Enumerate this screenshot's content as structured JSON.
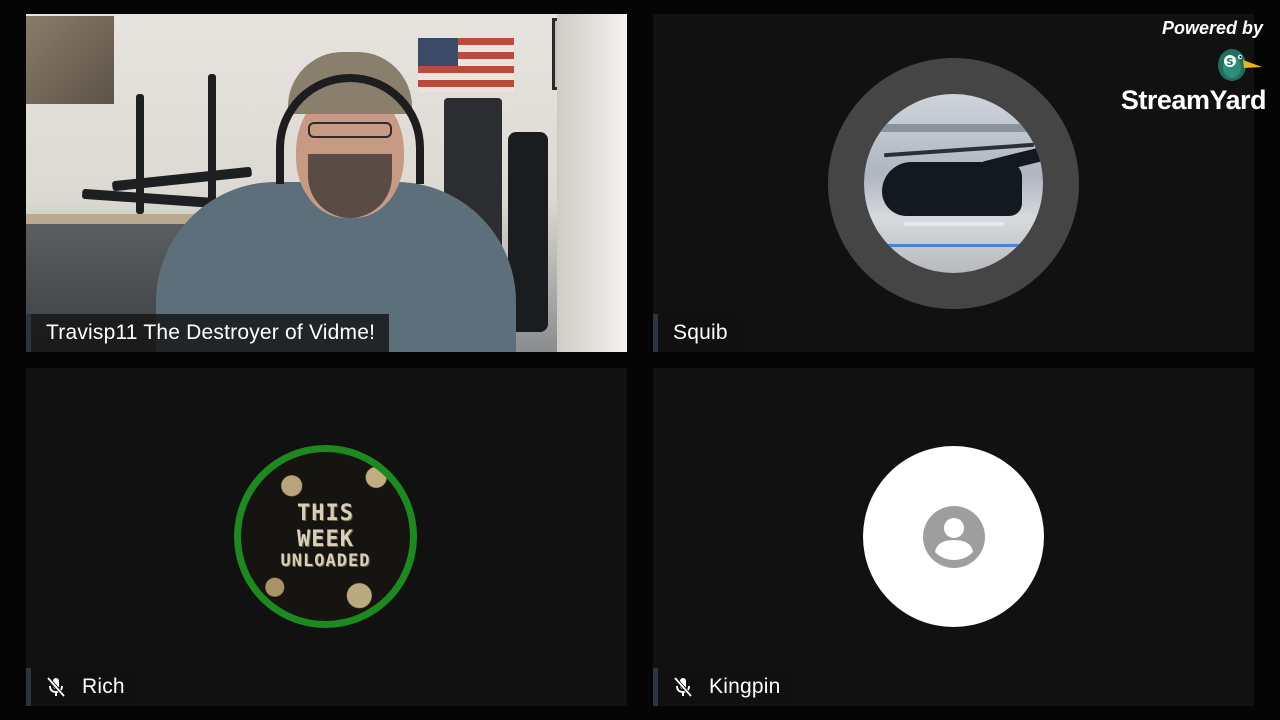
{
  "branding": {
    "powered_by": "Powered by",
    "product_name": "StreamYard",
    "logo_icon": "duck-logo-icon"
  },
  "participants": [
    {
      "name": "Travisp11 The Destroyer of Vidme!",
      "muted": false,
      "media": "camera-video"
    },
    {
      "name": "Squib",
      "muted": false,
      "media": "avatar-helicopter-photo"
    },
    {
      "name": "Rich",
      "muted": true,
      "media": "avatar-this-week-unloaded"
    },
    {
      "name": "Kingpin",
      "muted": true,
      "media": "avatar-default-person-icon"
    }
  ],
  "rich_avatar_text": [
    "THIS",
    "WEEK",
    "UNLOADED"
  ],
  "colors": {
    "background": "#050505",
    "tile": "#111111",
    "rich_ring": "#1d8a1f",
    "squib_ring": "#454545",
    "default_avatar": "#ffffff",
    "default_avatar_icon": "#9e9e9e"
  }
}
